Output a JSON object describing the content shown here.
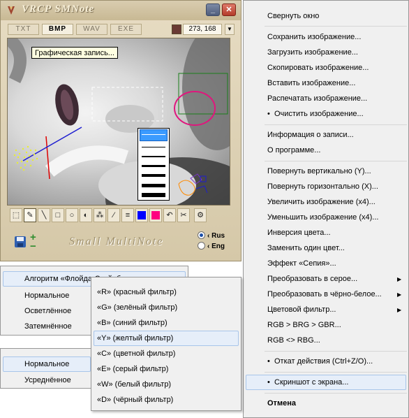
{
  "app": {
    "title": "VRCP SMNote",
    "tabs": [
      {
        "label": "TXT",
        "active": false
      },
      {
        "label": "BMP",
        "active": true
      },
      {
        "label": "WAV",
        "active": false
      },
      {
        "label": "EXE",
        "active": false
      }
    ],
    "current_color": "#6a3a35",
    "coords": "273, 168",
    "tooltip": "Графическая запись...",
    "brand": "Small MultiNote",
    "lang": {
      "rus": "Rus",
      "eng": "Eng",
      "selected": "Rus"
    },
    "tools": [
      "select-rect-icon",
      "lasso-icon",
      "line-icon",
      "rect-icon",
      "ellipse-icon",
      "fill-icon",
      "spray-icon",
      "eyedropper-icon",
      "line-width-icon",
      "color-blue",
      "color-pink",
      "undo-icon",
      "cut-icon",
      "settings-icon"
    ],
    "palette": {
      "blue": "#0000ff",
      "pink": "#ff0080"
    }
  },
  "main_menu": {
    "items": [
      {
        "label": "Свернуть окно"
      },
      {
        "label": "Сохранить изображение..."
      },
      {
        "label": "Загрузить изображение..."
      },
      {
        "label": "Скопировать изображение..."
      },
      {
        "label": "Вставить изображение..."
      },
      {
        "label": "Распечатать изображение..."
      },
      {
        "label": "Очистить изображение..."
      },
      {
        "label": "Информация о записи..."
      },
      {
        "label": "О программе..."
      },
      {
        "label": "Повернуть вертикально (Y)..."
      },
      {
        "label": "Повернуть горизонтально (X)..."
      },
      {
        "label": "Увеличить изображение (x4)..."
      },
      {
        "label": "Уменьшить изображение (x4)..."
      },
      {
        "label": "Инверсия цвета..."
      },
      {
        "label": "Заменить один цвет..."
      },
      {
        "label": "Эффект «Сепия»..."
      },
      {
        "label": "Преобразовать в серое..."
      },
      {
        "label": "Преобразовать в чёрно-белое..."
      },
      {
        "label": "Цветовой фильтр..."
      },
      {
        "label": "RGB > BRG > GBR..."
      },
      {
        "label": "RGB <> RBG..."
      },
      {
        "label": "Откат действия (Ctrl+Z/O)..."
      },
      {
        "label": "Скриншот с экрана..."
      },
      {
        "label": "Отмена"
      }
    ]
  },
  "algo_menu": {
    "items": [
      {
        "label": "Алгоритм «Флойда-Стейнберга»"
      },
      {
        "label": "Нормальное"
      },
      {
        "label": "Осветлённое"
      },
      {
        "label": "Затемнённое"
      }
    ]
  },
  "filter_menu": {
    "items": [
      {
        "label": "«R» (красный фильтр)"
      },
      {
        "label": "«G» (зелёный фильтр)"
      },
      {
        "label": "«B» (синий фильтр)"
      },
      {
        "label": "«Y» (желтый фильтр)"
      },
      {
        "label": "«C» (цветной фильтр)"
      },
      {
        "label": "«E» (серый фильтр)"
      },
      {
        "label": "«W» (белый фильтр)"
      },
      {
        "label": "«D» (чёрный фильтр)"
      }
    ]
  },
  "mode_menu": {
    "items": [
      {
        "label": "Нормальное"
      },
      {
        "label": "Усреднённое"
      }
    ]
  }
}
